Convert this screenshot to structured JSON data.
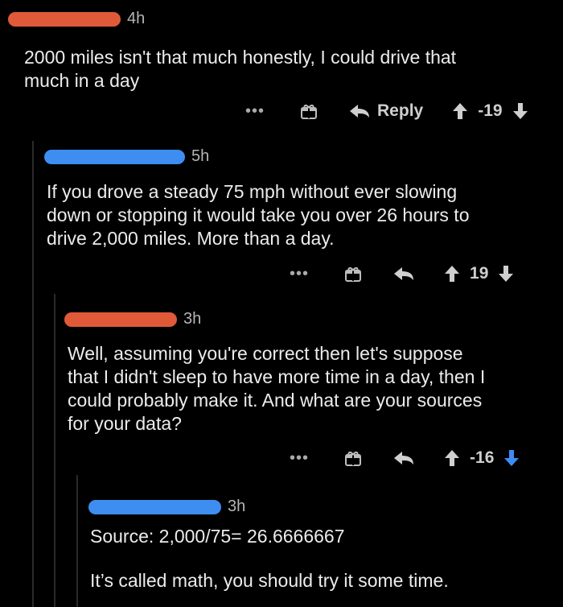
{
  "comments": [
    {
      "timestamp": "4h",
      "text": "2000 miles isn't that much honestly, I could drive that\nmuch in a day",
      "reply_label": "Reply",
      "score": "-19",
      "redact_color": "#e05a3a"
    },
    {
      "timestamp": "5h",
      "text": "If you drove a steady 75 mph without ever slowing\ndown or stopping it would take you over 26 hours to\ndrive 2,000 miles. More than a day.",
      "score": "19",
      "redact_color": "#3d8ef0"
    },
    {
      "timestamp": "3h",
      "text": "Well, assuming you're correct then let's suppose\nthat I didn't sleep to have more time in a day, then I\ncould probably make it. And what are your sources\nfor your data?",
      "score": "-16",
      "redact_color": "#e05a3a"
    },
    {
      "timestamp": "3h",
      "text_line1": "Source: 2,000/75= 26.6666667",
      "text_line2": "It’s called math, you should try it some time.",
      "redact_color": "#3d8ef0"
    }
  ],
  "icons": {
    "more": "more-icon",
    "gift": "gift-icon",
    "reply": "reply-arrow-icon",
    "upvote": "upvote-icon",
    "downvote": "downvote-icon"
  }
}
